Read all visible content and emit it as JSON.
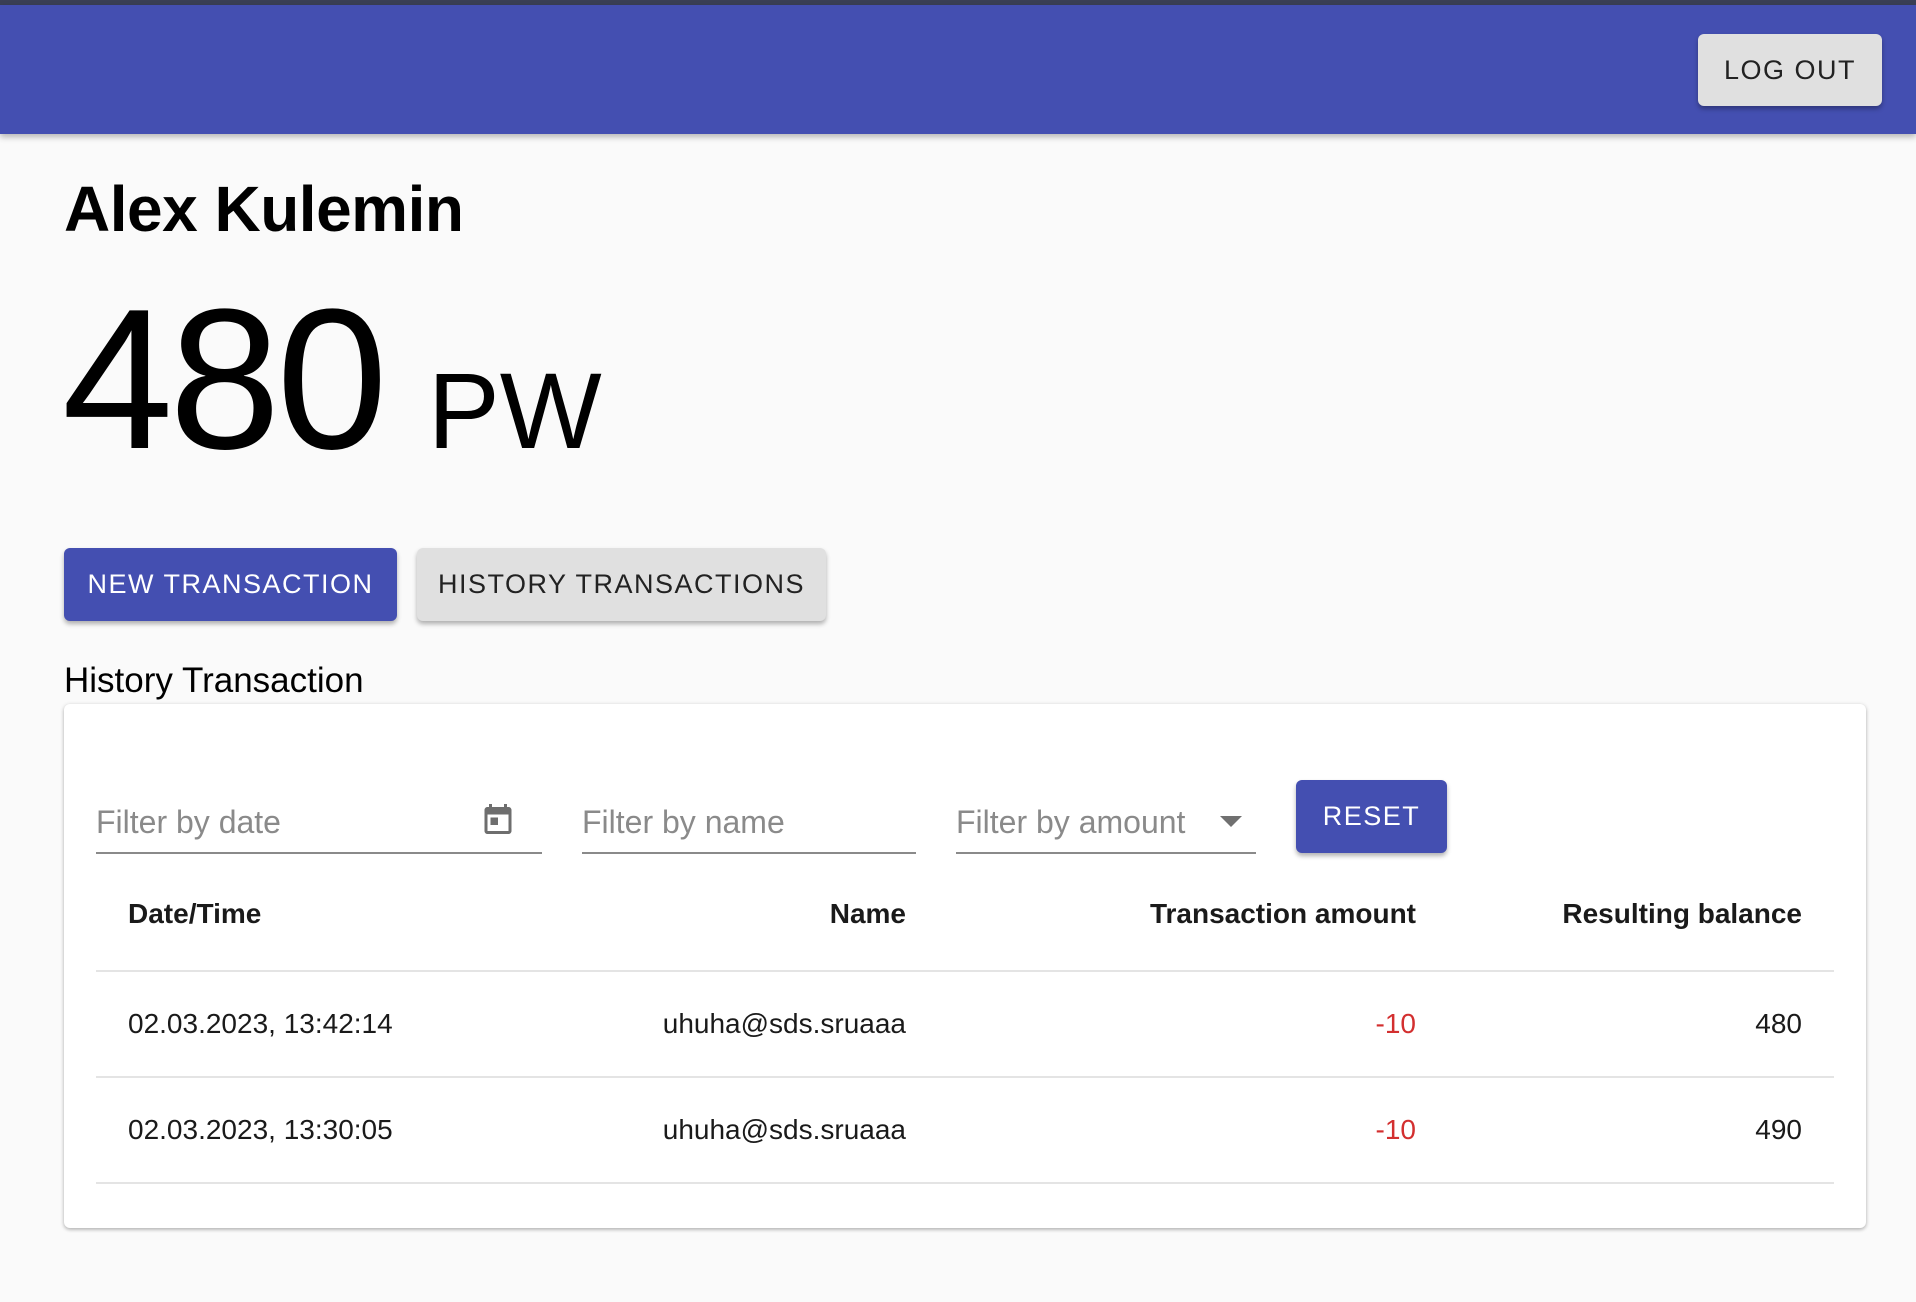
{
  "header": {
    "logout_label": "LOG OUT"
  },
  "user": {
    "name": "Alex Kulemin",
    "balance": "480",
    "currency": "PW"
  },
  "actions": {
    "new_transaction_label": "NEW TRANSACTION",
    "history_transactions_label": "HISTORY TRANSACTIONS"
  },
  "history": {
    "title": "History Transaction",
    "filters": {
      "date_placeholder": "Filter by date",
      "name_placeholder": "Filter by name",
      "amount_placeholder": "Filter by amount",
      "reset_label": "RESET"
    },
    "columns": [
      "Date/Time",
      "Name",
      "Transaction amount",
      "Resulting balance"
    ],
    "rows": [
      {
        "datetime": "02.03.2023, 13:42:14",
        "name": "uhuha@sds.sruaaa",
        "amount": "-10",
        "balance": "480"
      },
      {
        "datetime": "02.03.2023, 13:30:05",
        "name": "uhuha@sds.sruaaa",
        "amount": "-10",
        "balance": "490"
      }
    ]
  },
  "colors": {
    "primary": "#444fb1",
    "negative_amount": "#d32f2f",
    "secondary_button": "#e0e0e0"
  },
  "icons": {
    "date_filter": "calendar-icon",
    "amount_filter": "dropdown-caret-icon"
  }
}
